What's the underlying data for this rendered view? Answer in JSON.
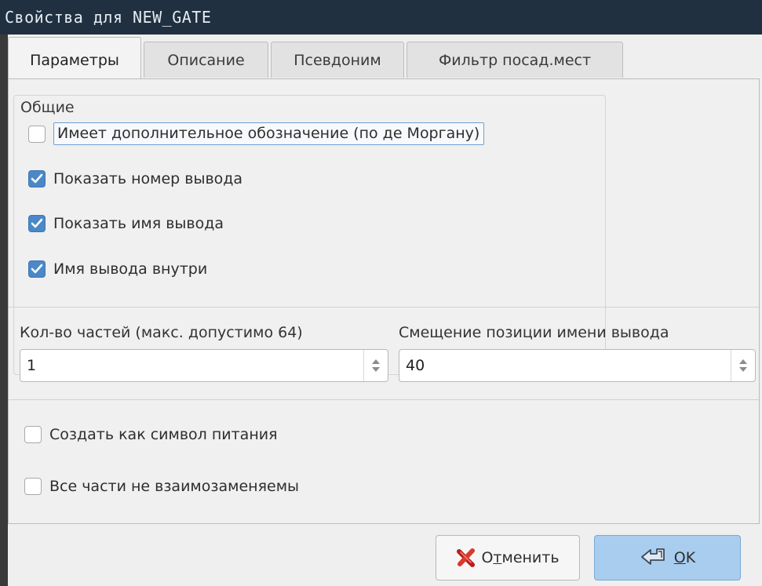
{
  "window": {
    "title": "Свойства для NEW_GATE"
  },
  "tabs": [
    {
      "label": "Параметры",
      "active": true
    },
    {
      "label": "Описание",
      "active": false
    },
    {
      "label": "Псевдоним",
      "active": false
    },
    {
      "label": "Фильтр посад.мест",
      "active": false
    }
  ],
  "general_group": {
    "title": "Общие",
    "options": [
      {
        "label": "Имеет дополнительное обозначение (по де Моргану)",
        "checked": false,
        "focused": true
      },
      {
        "label": "Показать номер вывода",
        "checked": true
      },
      {
        "label": "Показать имя вывода",
        "checked": true
      },
      {
        "label": "Имя вывода внутри",
        "checked": true
      }
    ]
  },
  "parts": {
    "label": "Кол-во частей (макс. допустимо 64)",
    "value": "1"
  },
  "pin_name_offset": {
    "label": "Смещение позиции имени вывода",
    "value": "40"
  },
  "options": [
    {
      "label": "Создать как символ питания",
      "checked": false
    },
    {
      "label": "Все части не взаимозаменяемы",
      "checked": false
    }
  ],
  "buttons": {
    "cancel": {
      "pre": "О",
      "mnemonic": "т",
      "post": "менить",
      "icon": "red-x-icon"
    },
    "ok": {
      "pre": "",
      "mnemonic": "O",
      "post": "K",
      "icon": "enter-arrow-icon"
    }
  },
  "colors": {
    "titlebar": "#203040",
    "checkbox_checked": "#4a88c8",
    "ok_button": "#a9cdee"
  }
}
